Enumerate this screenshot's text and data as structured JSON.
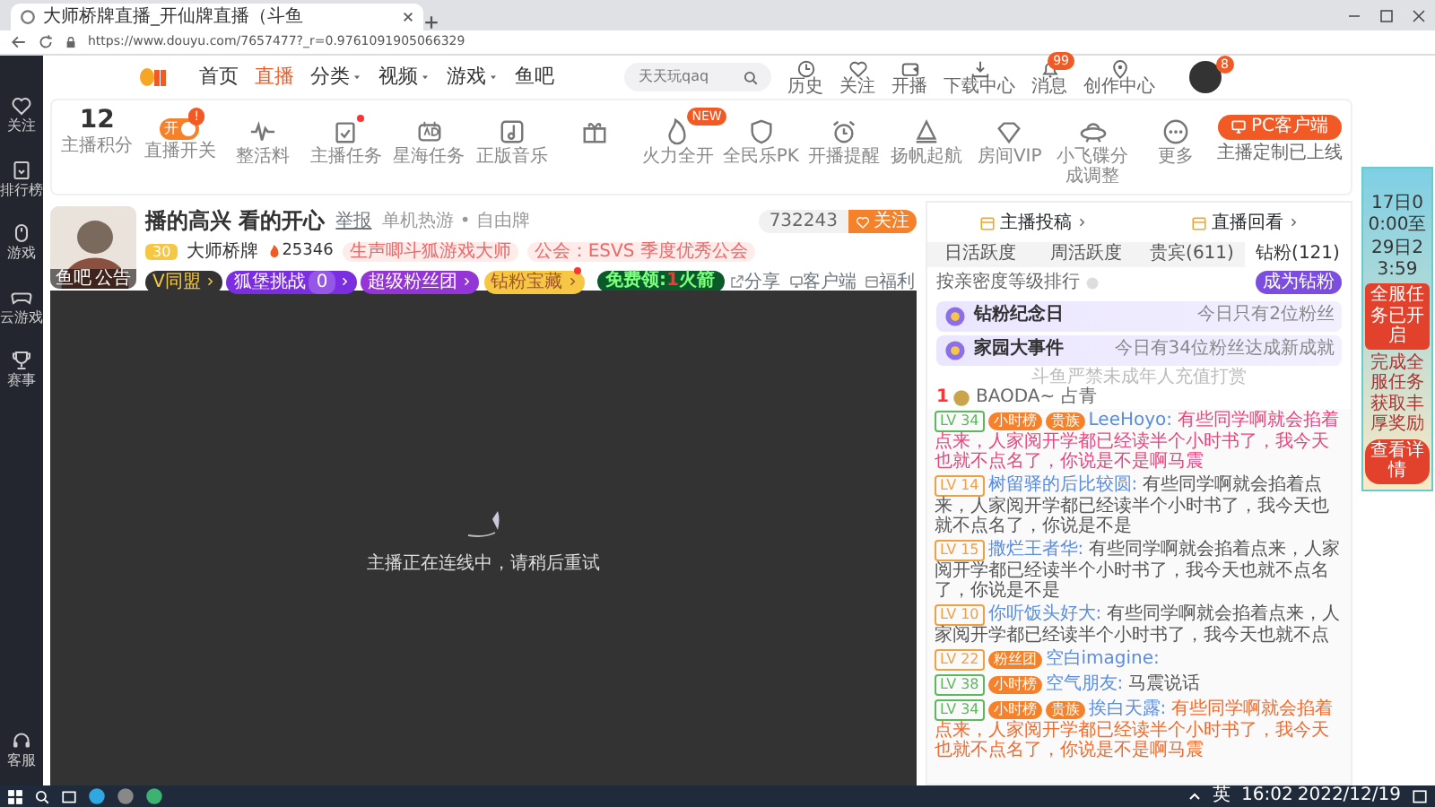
{
  "browser": {
    "tab_title": "大师桥牌直播_开仙牌直播（斗鱼",
    "url": "https://www.douyu.com/7657477?_r=0.9761091905066329"
  },
  "nav": {
    "links": [
      {
        "label": "首页",
        "selected": false,
        "dropdown": false
      },
      {
        "label": "直播",
        "selected": true,
        "dropdown": false
      },
      {
        "label": "分类",
        "selected": false,
        "dropdown": true
      },
      {
        "label": "视频",
        "selected": false,
        "dropdown": true
      },
      {
        "label": "游戏",
        "selected": false,
        "dropdown": true
      },
      {
        "label": "鱼吧",
        "selected": false,
        "dropdown": false
      }
    ],
    "search": {
      "placeholder": "天天玩qaq"
    },
    "actions": [
      {
        "label": "历史"
      },
      {
        "label": "关注"
      },
      {
        "label": "开播"
      },
      {
        "label": "下载中心"
      },
      {
        "label": "消息",
        "badge": "99"
      },
      {
        "label": "创作中心"
      }
    ],
    "avatar_badge": "8"
  },
  "sidebar": {
    "items": [
      {
        "label": "关注"
      },
      {
        "label": "排行榜"
      },
      {
        "label": "游戏"
      },
      {
        "label": "云游戏"
      },
      {
        "label": "赛事"
      }
    ],
    "bottom": {
      "label": "客服"
    }
  },
  "toolbar": {
    "score": {
      "value": "12",
      "label": "主播积分"
    },
    "tools": [
      {
        "kind": "toggle",
        "label": "直播开关",
        "on": true,
        "toggle_text": "开",
        "badge": "!",
        "dot": false
      },
      {
        "kind": "icon",
        "label": "整活料",
        "dot": false
      },
      {
        "kind": "icon",
        "label": "主播任务",
        "dot": true
      },
      {
        "kind": "icon",
        "label": "星海任务",
        "dot": false
      },
      {
        "kind": "icon",
        "label": "正版音乐",
        "dot": false
      },
      {
        "kind": "icon",
        "dot": false
      },
      {
        "kind": "icon",
        "label": "火力全开",
        "badge": "NEW",
        "dot": false
      },
      {
        "kind": "icon",
        "label": "全民乐PK",
        "dot": false
      },
      {
        "kind": "icon",
        "label": "开播提醒",
        "dot": false
      },
      {
        "kind": "icon",
        "label": "扬帆起航",
        "dot": false
      },
      {
        "kind": "icon",
        "label": "房间VIP",
        "dot": false
      },
      {
        "kind": "icon",
        "label": "小飞碟分成调整",
        "dot": false
      },
      {
        "kind": "icon",
        "label": "更多",
        "dot": false
      }
    ],
    "pc_button": "PC客户端",
    "pc_note": "主播定制已上线"
  },
  "room": {
    "avatar_links": [
      "鱼吧",
      "公告"
    ],
    "title": "播的高兴 看的开心",
    "report": "举报",
    "category": "单机热游 • 自由牌",
    "level": "30",
    "anchor": "大师桥牌",
    "heat": "25346",
    "tags": [
      "生声唧斗狐游戏大师",
      "公会：ESVS 季度优秀公会"
    ],
    "buttons": [
      {
        "label": "V同盟",
        "dot": false
      },
      {
        "label": "狐堡挑战",
        "count": "0",
        "dot": false
      },
      {
        "label": "超级粉丝团",
        "dot": false
      },
      {
        "label": "钻粉宝藏",
        "dot": true
      }
    ],
    "followers": "732243",
    "follow": "关注",
    "free_gift": {
      "prefix": "免费领:",
      "count": "1",
      "suffix": "火箭"
    },
    "links": [
      "分享",
      "客户端",
      "福利"
    ]
  },
  "video": {
    "message": "主播正在连线中，请稍后重试"
  },
  "panel": {
    "links": [
      "主播投稿",
      "直播回看"
    ],
    "tabs": [
      {
        "label": "日活跃度",
        "selected": false
      },
      {
        "label": "周活跃度",
        "selected": false
      },
      {
        "label": "贵宾(611)",
        "selected": false
      },
      {
        "label": "钻粉(121)",
        "selected": true
      }
    ],
    "rank_label": "按亲密度等级排行",
    "join": "成为钻粉",
    "banners": [
      {
        "title": "钻粉纪念日",
        "note": "今日只有2位粉丝"
      },
      {
        "title": "家园大事件",
        "note": "今日有34位粉丝达成新成就"
      }
    ],
    "notice": "斗鱼严禁未成年人充值打赏",
    "top_fan": {
      "rank": "1",
      "name": "BAODA~ 占青"
    }
  },
  "chat": [
    {
      "level": "LV 34",
      "color": "#5cb85c",
      "badges": [
        "小时榜",
        "贵族"
      ],
      "user": "LeeHoyo:",
      "text": "有些同学啊就会掐着点来，人家阅开学都已经读半个小时书了，我今天也就不点名了，你说是不是啊马震",
      "kind": "pink"
    },
    {
      "level": "LV 14",
      "color": "#f0a040",
      "user": "树留驿的后比较圆:",
      "text": "有些同学啊就会掐着点来，人家阅开学都已经读半个小时书了，我今天也就不点名了，你说是不是",
      "kind": "plain"
    },
    {
      "level": "LV 15",
      "color": "#f0a040",
      "user": "撒烂王者华:",
      "text": "有些同学啊就会掐着点来，人家阅开学都已经读半个小时书了，我今天也就不点名了，你说是不是",
      "kind": "plain"
    },
    {
      "level": "LV 10",
      "color": "#f0a040",
      "user": "你听饭头好大:",
      "text": "有些同学啊就会掐着点来，人家阅开学都已经读半个小时书了，我今天也就不点",
      "kind": "plain"
    },
    {
      "level": "LV 22",
      "color": "#f0a040",
      "badges": [
        "粉丝团"
      ],
      "user": "空白imagine:"
    },
    {
      "level": "LV 38",
      "color": "#5cb85c",
      "badges": [
        "小时榜"
      ],
      "user": "空气朋友:",
      "text": "马震说话",
      "kind": "plain"
    },
    {
      "level": "LV 34",
      "color": "#5cb85c",
      "badges": [
        "小时榜",
        "贵族"
      ],
      "user": "挨白天露:",
      "text": "有些同学啊就会掐着点来，人家阅开学都已经读半个小时书了，我今天也就不点名了，你说是不是啊马震",
      "kind": "orange"
    }
  ],
  "ad": {
    "dates": [
      "17日00:00至",
      "29日23:59"
    ],
    "title": "全服任务已开启",
    "body": "完成全服任务获取丰厚奖励",
    "button": "查看详情"
  },
  "taskbar": {
    "ime": "英",
    "time": "16:02",
    "date": "2022/12/19"
  }
}
